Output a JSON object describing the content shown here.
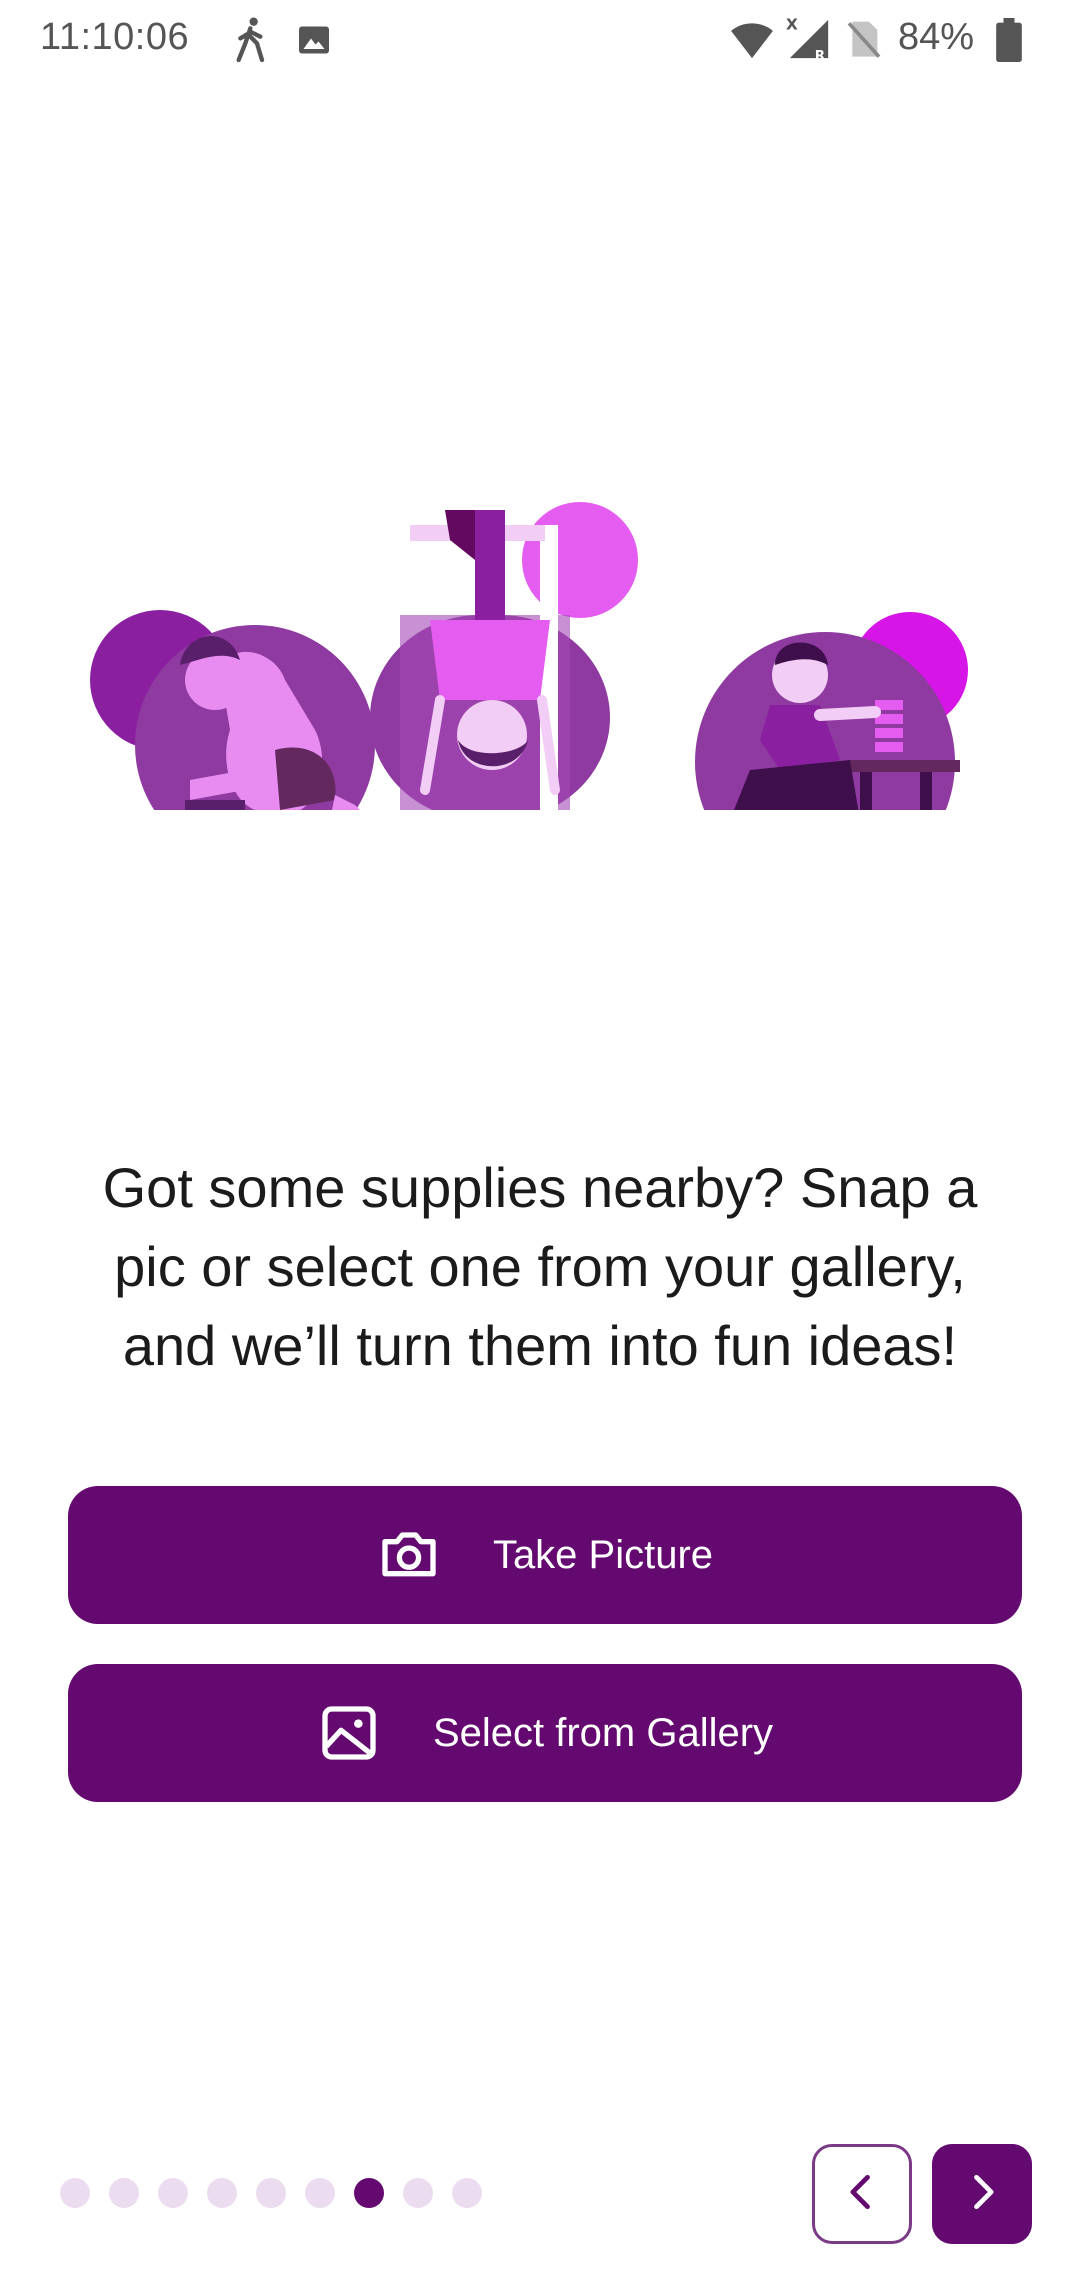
{
  "status_bar": {
    "time": "11:10:06",
    "battery": "84%",
    "icons": [
      "walking-icon",
      "image-icon",
      "wifi-icon",
      "signal-icon",
      "no-sim-icon",
      "battery-icon"
    ],
    "signal_badge_x": "X",
    "signal_badge_r": "R"
  },
  "content": {
    "prompt": "Got some supplies nearby? Snap a pic or select one from your gallery, and we’ll turn them into fun ideas!",
    "take_picture_label": "Take Picture",
    "select_gallery_label": "Select from Gallery"
  },
  "pager": {
    "total": 9,
    "active_index": 6
  },
  "colors": {
    "primary": "#63096f",
    "accent_magenta": "#d616e6",
    "circle_purple": "#8e3aa0",
    "light_pink": "#e98cf2",
    "dot_inactive": "#ecdcef"
  }
}
